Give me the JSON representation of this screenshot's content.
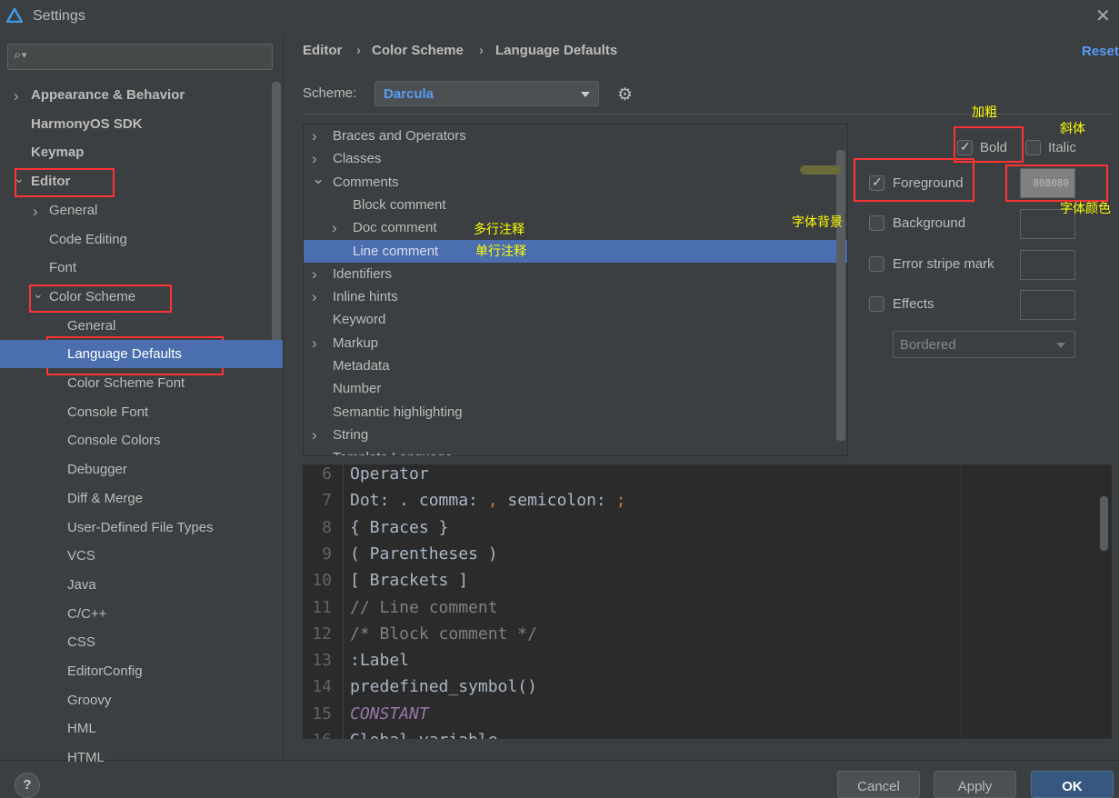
{
  "window": {
    "title": "Settings"
  },
  "sidebar": {
    "items": [
      {
        "label": "Appearance & Behavior",
        "bold": true,
        "chevron": "right",
        "indent": 0
      },
      {
        "label": "HarmonyOS SDK",
        "bold": true,
        "indent": 0
      },
      {
        "label": "Keymap",
        "bold": true,
        "indent": 0
      },
      {
        "label": "Editor",
        "bold": true,
        "chevron": "down",
        "indent": 0
      },
      {
        "label": "General",
        "chevron": "right",
        "indent": 1
      },
      {
        "label": "Code Editing",
        "indent": 1
      },
      {
        "label": "Font",
        "indent": 1
      },
      {
        "label": "Color Scheme",
        "chevron": "down",
        "indent": 1
      },
      {
        "label": "General",
        "indent": 2
      },
      {
        "label": "Language Defaults",
        "indent": 2,
        "selected": true
      },
      {
        "label": "Color Scheme Font",
        "indent": 2
      },
      {
        "label": "Console Font",
        "indent": 2
      },
      {
        "label": "Console Colors",
        "indent": 2
      },
      {
        "label": "Debugger",
        "indent": 2
      },
      {
        "label": "Diff & Merge",
        "indent": 2
      },
      {
        "label": "User-Defined File Types",
        "indent": 2
      },
      {
        "label": "VCS",
        "indent": 2
      },
      {
        "label": "Java",
        "indent": 2
      },
      {
        "label": "C/C++",
        "indent": 2
      },
      {
        "label": "CSS",
        "indent": 2
      },
      {
        "label": "EditorConfig",
        "indent": 2
      },
      {
        "label": "Groovy",
        "indent": 2
      },
      {
        "label": "HML",
        "indent": 2
      },
      {
        "label": "HTML",
        "indent": 2
      }
    ]
  },
  "breadcrumb": [
    "Editor",
    "Color Scheme",
    "Language Defaults"
  ],
  "reset_label": "Reset",
  "scheme": {
    "label": "Scheme:",
    "value": "Darcula"
  },
  "tree": {
    "items": [
      {
        "label": "Braces and Operators",
        "chevron": "right",
        "indent": 0
      },
      {
        "label": "Classes",
        "chevron": "right",
        "indent": 0
      },
      {
        "label": "Comments",
        "chevron": "down",
        "indent": 0
      },
      {
        "label": "Block comment",
        "indent": 1
      },
      {
        "label": "Doc comment",
        "chevron": "right",
        "indent": 1
      },
      {
        "label": "Line comment",
        "indent": 1,
        "selected": true
      },
      {
        "label": "Identifiers",
        "chevron": "right",
        "indent": 0
      },
      {
        "label": "Inline hints",
        "chevron": "right",
        "indent": 0
      },
      {
        "label": "Keyword",
        "indent": 0
      },
      {
        "label": "Markup",
        "chevron": "right",
        "indent": 0
      },
      {
        "label": "Metadata",
        "indent": 0
      },
      {
        "label": "Number",
        "indent": 0
      },
      {
        "label": "Semantic highlighting",
        "indent": 0
      },
      {
        "label": "String",
        "chevron": "right",
        "indent": 0
      },
      {
        "label": "Template Language",
        "indent": 0
      }
    ]
  },
  "attributes": {
    "bold": {
      "label": "Bold",
      "checked": true
    },
    "italic": {
      "label": "Italic",
      "checked": false
    },
    "foreground": {
      "label": "Foreground",
      "checked": true,
      "color": "808080"
    },
    "background": {
      "label": "Background",
      "checked": false
    },
    "error_stripe": {
      "label": "Error stripe mark",
      "checked": false
    },
    "effects": {
      "label": "Effects",
      "checked": false
    },
    "effect_type": "Bordered"
  },
  "editor": {
    "lines": [
      {
        "n": "6",
        "text": "Operator",
        "color": "#a9b7c6"
      },
      {
        "n": "7",
        "parts": [
          [
            "Dot: . comma: ",
            "#a9b7c6"
          ],
          [
            ",",
            "#cc7832"
          ],
          [
            " semicolon: ",
            "#a9b7c6"
          ],
          [
            ";",
            "#cc7832"
          ]
        ]
      },
      {
        "n": "8",
        "text": "{ Braces }",
        "color": "#a9b7c6"
      },
      {
        "n": "9",
        "text": "( Parentheses )",
        "color": "#a9b7c6"
      },
      {
        "n": "10",
        "text": "[ Brackets ]",
        "color": "#a9b7c6"
      },
      {
        "n": "11",
        "text": "// Line comment",
        "color": "#808080"
      },
      {
        "n": "12",
        "text": "/* Block comment */",
        "color": "#808080"
      },
      {
        "n": "13",
        "text": ":Label",
        "color": "#a9b7c6"
      },
      {
        "n": "14",
        "text": "predefined_symbol()",
        "color": "#a9b7c6"
      },
      {
        "n": "15",
        "text": "CONSTANT",
        "color": "#9876aa",
        "italic": true
      },
      {
        "n": "16",
        "text": "Global variable",
        "color": "#a9b7c6"
      }
    ]
  },
  "buttons": {
    "help": "?",
    "cancel": "Cancel",
    "apply": "Apply",
    "ok": "OK"
  },
  "annotations": {
    "bold": "加粗",
    "italic": "斜体",
    "font_color": "字体颜色",
    "font_background": "字体背景",
    "multiline_comment": "多行注释",
    "single_line_comment": "单行注释"
  },
  "colors": {
    "accent": "#4b6eaf",
    "link": "#589df6",
    "highlight_box": "#ff3333",
    "annotation": "#ffff00"
  }
}
